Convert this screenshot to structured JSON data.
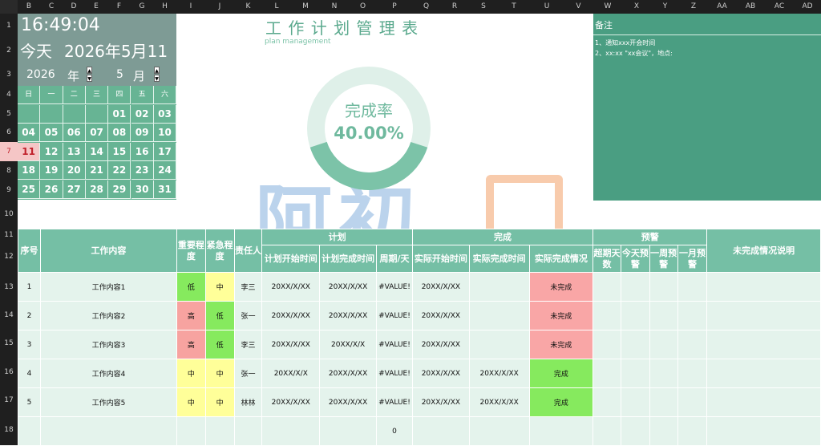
{
  "columns": [
    "B",
    "C",
    "D",
    "E",
    "F",
    "G",
    "H",
    "I",
    "J",
    "K",
    "L",
    "M",
    "N",
    "O",
    "P",
    "Q",
    "R",
    "S",
    "T",
    "U",
    "V",
    "W",
    "X",
    "Y",
    "Z",
    "AA",
    "AB",
    "AC",
    "AD"
  ],
  "rows": [
    "1",
    "2",
    "3",
    "4",
    "5",
    "6",
    "7",
    "8",
    "9",
    "10",
    "11",
    "12",
    "13",
    "14",
    "15",
    "16",
    "17",
    "18"
  ],
  "clock": {
    "time": "16:49:04",
    "today_label": "今天",
    "today_date": "2026年5月11日",
    "year": "2026",
    "year_unit": "年",
    "month": "5",
    "month_unit": "月",
    "up_arrow": "▲",
    "down_arrow": "▼"
  },
  "calendar": {
    "weekdays": [
      "日",
      "一",
      "二",
      "三",
      "四",
      "五",
      "六"
    ],
    "weeks": [
      [
        "",
        "",
        "",
        "",
        "01",
        "02",
        "03"
      ],
      [
        "04",
        "05",
        "06",
        "07",
        "08",
        "09",
        "10"
      ],
      [
        "11",
        "12",
        "13",
        "14",
        "15",
        "16",
        "17"
      ],
      [
        "18",
        "19",
        "20",
        "21",
        "22",
        "23",
        "24"
      ],
      [
        "25",
        "26",
        "27",
        "28",
        "29",
        "30",
        "31"
      ]
    ],
    "today": "11"
  },
  "title": {
    "main": "工 作 计 划 管 理 表",
    "sub": "plan management"
  },
  "progress": {
    "label": "完成率",
    "value_text": "40.00%",
    "value": 0.4,
    "ring_fill_color": "#7cc3a8",
    "ring_track_color": "#dff0e9"
  },
  "watermark": {
    "text": "阿初"
  },
  "notes": {
    "title": "备注",
    "lines": [
      "1、通知xxx开会时间",
      "2、xx:xx \"xx会议\"，地点:"
    ]
  },
  "table": {
    "headers": {
      "seq": "序号",
      "content": "工作内容",
      "importance": "重要程度",
      "urgency": "紧急程度",
      "owner": "责任人",
      "plan_group": "计划",
      "plan_start": "计划开始时间",
      "plan_end": "计划完成时间",
      "period": "周期/天",
      "done_group": "完成",
      "actual_start": "实际开始时间",
      "actual_end": "实际完成时间",
      "actual_status": "实际完成情况",
      "warn_group": "预警",
      "overdue": "超期天数",
      "today_warn": "今天预警",
      "week_warn": "一周预警",
      "month_warn": "一月预警",
      "unfinished": "未完成情况说明"
    },
    "rows": [
      {
        "seq": "1",
        "content": "工作内容1",
        "importance": "低",
        "urgency": "中",
        "owner": "李三",
        "plan_start": "20XX/X/XX",
        "plan_end": "20XX/X/XX",
        "period": "#VALUE!",
        "actual_start": "20XX/X/XX",
        "actual_end": "",
        "status": "未完成"
      },
      {
        "seq": "2",
        "content": "工作内容2",
        "importance": "高",
        "urgency": "低",
        "owner": "张一",
        "plan_start": "20XX/X/XX",
        "plan_end": "20XX/X/XX",
        "period": "#VALUE!",
        "actual_start": "20XX/X/XX",
        "actual_end": "",
        "status": "未完成"
      },
      {
        "seq": "3",
        "content": "工作内容3",
        "importance": "高",
        "urgency": "低",
        "owner": "李三",
        "plan_start": "20XX/X/XX",
        "plan_end": "20XX/X/X",
        "period": "#VALUE!",
        "actual_start": "20XX/X/XX",
        "actual_end": "",
        "status": "未完成"
      },
      {
        "seq": "4",
        "content": "工作内容4",
        "importance": "中",
        "urgency": "中",
        "owner": "张一",
        "plan_start": "20XX/X/X",
        "plan_end": "20XX/X/XX",
        "period": "#VALUE!",
        "actual_start": "20XX/X/XX",
        "actual_end": "20XX/X/XX",
        "status": "完成"
      },
      {
        "seq": "5",
        "content": "工作内容5",
        "importance": "中",
        "urgency": "中",
        "owner": "林林",
        "plan_start": "20XX/X/XX",
        "plan_end": "20XX/X/XX",
        "period": "#VALUE!",
        "actual_start": "20XX/X/XX",
        "actual_end": "20XX/X/XX",
        "status": "完成"
      }
    ],
    "total_period": "0"
  },
  "colors": {
    "header_teal": "#75bfa5",
    "cell_mint": "#e4f3ec",
    "low_green": "#86ea5e",
    "high_pink": "#f7a3a0",
    "mid_yellow": "#ffff99",
    "not_done_red": "#f9a6a6",
    "done_green": "#86ea5e"
  }
}
